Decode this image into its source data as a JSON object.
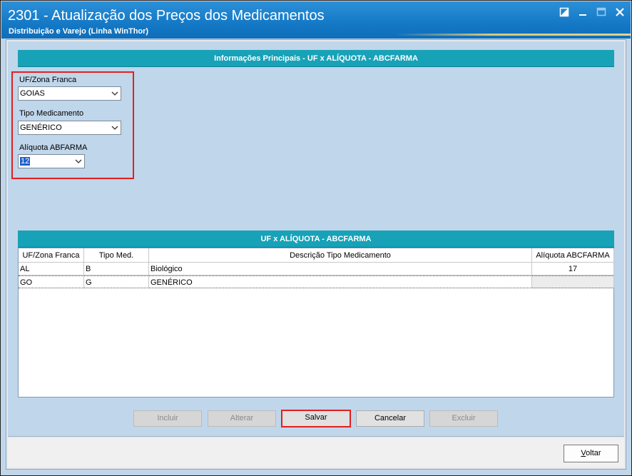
{
  "window": {
    "title": "2301 - Atualização dos Preços dos Medicamentos",
    "subtitle": "Distribuição e Varejo (Linha WinThor)",
    "controls": [
      "restore-icon",
      "minimize-icon",
      "maximize-icon",
      "close-icon"
    ]
  },
  "info_section": {
    "header": "Informações Principais - UF x ALÍQUOTA - ABCFARMA",
    "uf_label": "UF/Zona Franca",
    "uf_value": "GOIAS",
    "tipo_label": "Tipo Medicamento",
    "tipo_value": "GENÉRICO",
    "aliquota_label": "Alíquota ABFARMA",
    "aliquota_value": "12"
  },
  "grid_section": {
    "header": "UF x ALÍQUOTA - ABCFARMA",
    "columns": [
      "UF/Zona Franca",
      "Tipo Med.",
      "Descrição Tipo Medicamento",
      "Alíquota ABCFARMA"
    ],
    "rows": [
      {
        "uf": "AL",
        "tipo": "B",
        "descricao": "Biológico",
        "aliquota": "17"
      },
      {
        "uf": "GO",
        "tipo": "G",
        "descricao": "GENÉRICO",
        "aliquota": ""
      }
    ]
  },
  "actions": {
    "incluir": "Incluir",
    "alterar": "Alterar",
    "salvar": "Salvar",
    "cancelar": "Cancelar",
    "excluir": "Excluir"
  },
  "footer": {
    "voltar_prefix": "",
    "voltar_underlined": "V",
    "voltar_rest": "oltar"
  },
  "colors": {
    "title_bar": "#1479c6",
    "section_header": "#17a2b8",
    "panel": "#c0d6ea",
    "highlight_box": "#e02020"
  }
}
